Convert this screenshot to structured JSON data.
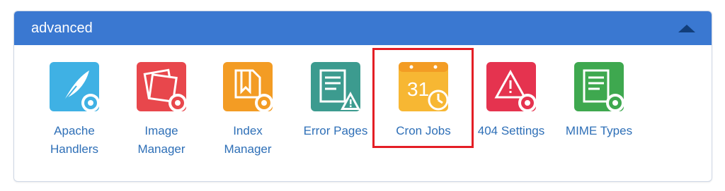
{
  "panel": {
    "title": "advanced",
    "collapse_icon": "caret-up-icon"
  },
  "tools": [
    {
      "label_line1": "Apache",
      "label_line2": "Handlers",
      "icon": "feather-gear-icon",
      "color": "#3fb1e4"
    },
    {
      "label_line1": "Image",
      "label_line2": "Manager",
      "icon": "photos-gear-icon",
      "color": "#e8474c"
    },
    {
      "label_line1": "Index",
      "label_line2": "Manager",
      "icon": "bookmark-gear-icon",
      "color": "#f39c24"
    },
    {
      "label_line1": "Error Pages",
      "label_line2": "",
      "icon": "document-warning-icon",
      "color": "#3c9b8f"
    },
    {
      "label_line1": "Cron Jobs",
      "label_line2": "",
      "icon": "calendar-clock-icon",
      "color": "#f7b733"
    },
    {
      "label_line1": "404 Settings",
      "label_line2": "",
      "icon": "warning-gear-icon",
      "color": "#e5334f"
    },
    {
      "label_line1": "MIME Types",
      "label_line2": "",
      "icon": "document-gear-icon",
      "color": "#3ea84f"
    }
  ],
  "highlight_color": "#e41e25"
}
